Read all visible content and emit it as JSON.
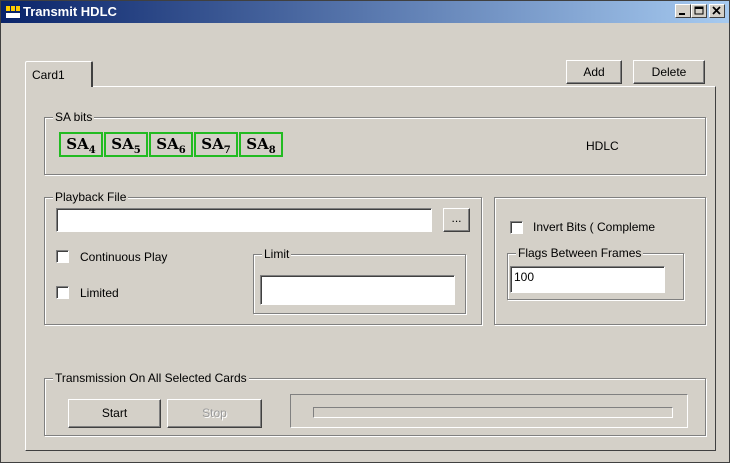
{
  "window": {
    "title": "Transmit HDLC"
  },
  "tabs": [
    {
      "label": "Card1"
    }
  ],
  "toolbar": {
    "add_label": "Add",
    "delete_label": "Delete"
  },
  "sa_bits": {
    "legend": "SA bits",
    "items": [
      {
        "letters": "SA",
        "sub": "4"
      },
      {
        "letters": "SA",
        "sub": "5"
      },
      {
        "letters": "SA",
        "sub": "6"
      },
      {
        "letters": "SA",
        "sub": "7"
      },
      {
        "letters": "SA",
        "sub": "8"
      }
    ],
    "selected_color": "#22bb22",
    "mode_label": "HDLC"
  },
  "playback": {
    "legend": "Playback File",
    "file_value": "",
    "browse_label": "...",
    "continuous_label": "Continuous Play",
    "continuous_checked": false,
    "limited_label": "Limited",
    "limited_checked": false,
    "limit_legend": "Limit",
    "limit_value": ""
  },
  "options": {
    "invert_label": "Invert Bits ( Compleme",
    "invert_checked": false,
    "flags_legend": "Flags Between Frames",
    "flags_value": "100"
  },
  "transmission": {
    "legend": "Transmission On All Selected Cards",
    "start_label": "Start",
    "stop_label": "Stop",
    "progress": 0
  }
}
